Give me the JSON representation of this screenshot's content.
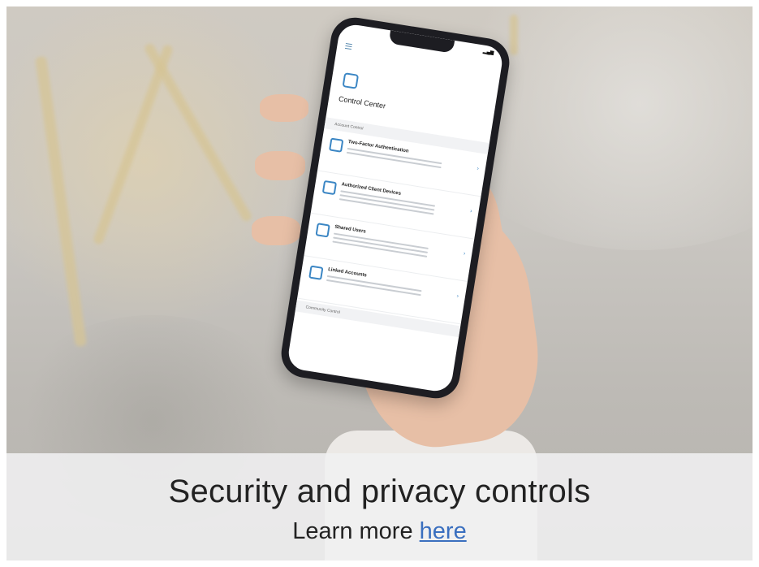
{
  "banner": {
    "title": "Security and privacy controls",
    "learn_more_prefix": "Learn more",
    "link_label": "here",
    "link_color": "#3a6fbf"
  },
  "phone_screen": {
    "app_title": "Control Center",
    "section_account": "Account Control",
    "section_community": "Community Control",
    "items": [
      {
        "label": "Two-Factor Authentication",
        "icon": "key-icon"
      },
      {
        "label": "Authorized Client Devices",
        "icon": "phone-device-icon"
      },
      {
        "label": "Shared Users",
        "icon": "users-icon"
      },
      {
        "label": "Linked Accounts",
        "icon": "link-icon"
      }
    ]
  },
  "colors": {
    "accent": "#3b86c4",
    "caption_background": "#f0f0f1"
  }
}
